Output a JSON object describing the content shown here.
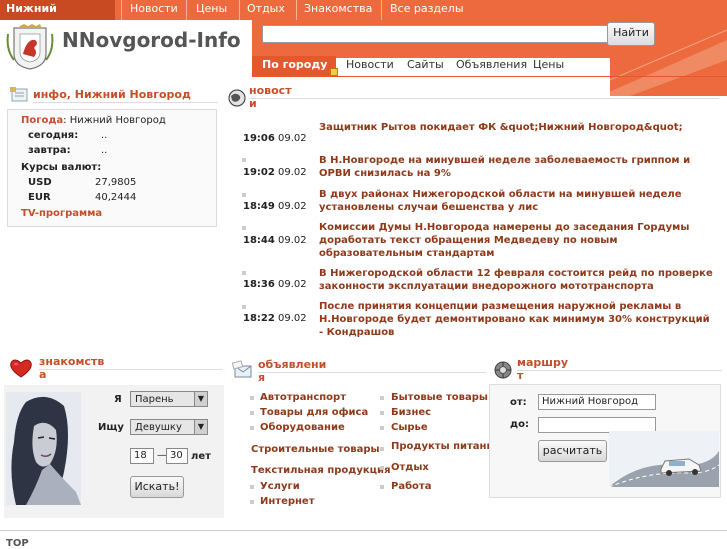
{
  "topnav": {
    "items": [
      "Нижний Новгород",
      "Новости",
      "Цены",
      "Отдых",
      "Знакомства",
      "Все разделы"
    ]
  },
  "header": {
    "logo_text": "NNovgorod-Info",
    "search_button": "Найти",
    "search_value": "",
    "tabs": [
      "По городу",
      "Новости",
      "Сайты",
      "Объявления",
      "Цены"
    ]
  },
  "info": {
    "title": "инфо, Нижний Новгород",
    "weather_label": "Погода",
    "weather_city": "Нижний Новгород",
    "today_label": "сегодня",
    "today_value": "..",
    "tomorrow_label": "завтра",
    "tomorrow_value": "..",
    "rates_label": "Курсы валют:",
    "usd_label": "USD",
    "usd_value": "27,9805",
    "eur_label": "EUR",
    "eur_value": "40,2444",
    "tv_link": "TV-программа"
  },
  "news": {
    "title_line1": "новост",
    "title_line2": "и",
    "items": [
      {
        "time": "19:06",
        "date": "09.02",
        "title": "Защитник Рытов покидает ФК &quot;Нижний Новгород&quot;"
      },
      {
        "time": "19:02",
        "date": "09.02",
        "title": "В Н.Новгороде на минувшей неделе заболеваемость гриппом и ОРВИ снизилась на 9%"
      },
      {
        "time": "18:49",
        "date": "09.02",
        "title": "В двух районах Нижегородской области на минувшей неделе установлены случаи бешенства у лис"
      },
      {
        "time": "18:44",
        "date": "09.02",
        "title": "Комиссии Думы Н.Новгорода намерены до заседания Гордумы доработать текст обращения Медведеву по новым образовательным стандартам"
      },
      {
        "time": "18:36",
        "date": "09.02",
        "title": "В Нижегородской области 12 февраля состоится рейд по проверке законности эксплуатации внедорожного мототранспорта"
      },
      {
        "time": "18:22",
        "date": "09.02",
        "title": "После принятия концепции размещения наружной рекламы в Н.Новгороде будет демонтировано как минимум 30% конструкций - Кондрашов"
      }
    ]
  },
  "dating": {
    "title_line1": "знакомств",
    "title_line2": "а",
    "ya_label": "Я",
    "ya_value": "Парень",
    "seek_label": "Ищу",
    "seek_value": "Девушку",
    "age_from": "18",
    "age_sep": "—",
    "age_to": "30",
    "age_unit": "лет",
    "search_button": "Искать!"
  },
  "ads": {
    "title_line1": "объявлени",
    "title_line2": "я",
    "col1": [
      "Автотранспорт",
      "Товары для офиса",
      "Оборудование",
      "Строительные товары",
      "Текстильная продукция",
      "Услуги",
      "Интернет"
    ],
    "col2": [
      "Бытовые товары",
      "Бизнес",
      "Сырье",
      "Продукты питания",
      "Отдых",
      "Работа"
    ]
  },
  "route": {
    "title_line1": "маршру",
    "title_line2": "т",
    "from_label": "от:",
    "from_value": "Нижний Новгород",
    "to_label": "до:",
    "to_value": "",
    "calc_button": "расчитать"
  },
  "footer": {
    "cut_text": "TOP"
  },
  "colors": {
    "accent": "#ec6a3e",
    "accent_dark": "#c84a23",
    "link": "#8e3a1b"
  }
}
